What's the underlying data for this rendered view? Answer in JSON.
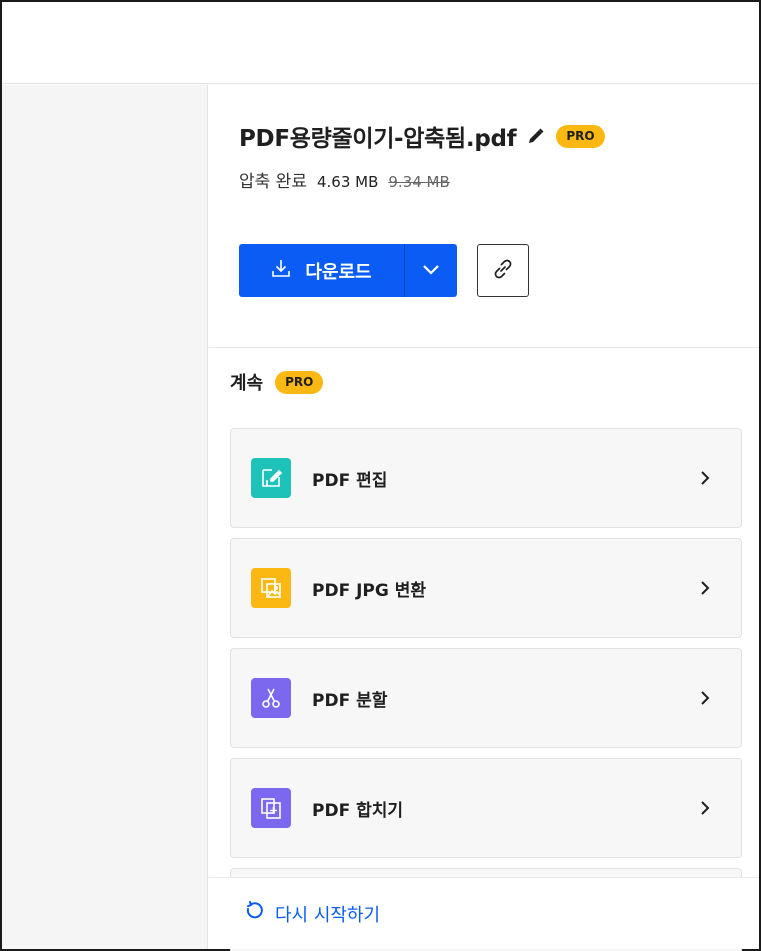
{
  "file": {
    "name": "PDF용량줄이기-압축됨.pdf",
    "badge": "PRO",
    "status": "압축 완료",
    "new_size": "4.63 MB",
    "old_size": "9.34 MB"
  },
  "actions": {
    "download_label": "다운로드"
  },
  "continue_section": {
    "label": "계속",
    "badge": "PRO",
    "tools": [
      {
        "label": "PDF 편집",
        "icon": "edit-icon",
        "color": "#1ec2b8"
      },
      {
        "label": "PDF JPG 변환",
        "icon": "image-icon",
        "color": "#fbb813"
      },
      {
        "label": "PDF 분할",
        "icon": "scissors-icon",
        "color": "#7b68ee"
      },
      {
        "label": "PDF 합치기",
        "icon": "merge-icon",
        "color": "#7b68ee"
      }
    ]
  },
  "footer": {
    "restart_label": "다시 시작하기"
  },
  "colors": {
    "accent": "#0a5cf5",
    "pro": "#fbb813"
  }
}
